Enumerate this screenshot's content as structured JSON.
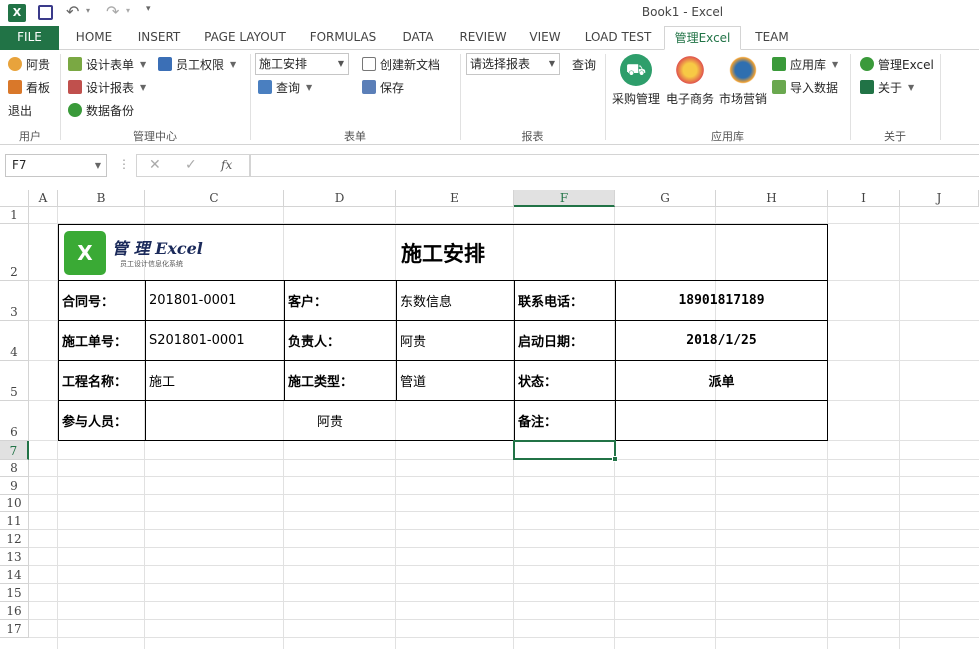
{
  "title": "Book1 - Excel",
  "qat": {
    "customize": "▾"
  },
  "tabs": [
    {
      "label": "FILE"
    },
    {
      "label": "HOME"
    },
    {
      "label": "INSERT"
    },
    {
      "label": "PAGE LAYOUT"
    },
    {
      "label": "FORMULAS"
    },
    {
      "label": "DATA"
    },
    {
      "label": "REVIEW"
    },
    {
      "label": "VIEW"
    },
    {
      "label": "LOAD TEST"
    },
    {
      "label": "管理Excel"
    },
    {
      "label": "TEAM"
    }
  ],
  "ribbon": {
    "user": {
      "name": "阿贵",
      "view": "看板",
      "logout": "退出",
      "group": "用户"
    },
    "manage": {
      "design_form": "设计表单",
      "staff_perm": "员工权限",
      "design_report": "设计报表",
      "backup": "数据备份",
      "group": "管理中心"
    },
    "form": {
      "select_value": "施工安排",
      "query": "查询",
      "create_doc": "创建新文档",
      "save": "保存",
      "group": "表单"
    },
    "report": {
      "select_value": "请选择报表",
      "query": "查询",
      "group": "报表"
    },
    "apps": {
      "purchase": "采购管理",
      "ecommerce": "电子商务",
      "marketing": "市场营销",
      "app_store": "应用库",
      "import": "导入数据",
      "group": "应用库"
    },
    "about": {
      "manage_excel": "管理Excel",
      "about": "关于",
      "group": "关于"
    }
  },
  "formula_bar": {
    "name_box": "F7",
    "fx": "fx",
    "formula": ""
  },
  "columns": [
    "A",
    "B",
    "C",
    "D",
    "E",
    "F",
    "G",
    "H",
    "I",
    "J"
  ],
  "rows": [
    "1",
    "2",
    "3",
    "4",
    "5",
    "6",
    "7",
    "8",
    "9",
    "10",
    "11",
    "12",
    "13",
    "14",
    "15",
    "16",
    "17"
  ],
  "logo": {
    "text": "管 理 Excel",
    "sub": "员工设计信息化系统"
  },
  "form_table": {
    "title": "施工安排",
    "contract_no_label": "合同号：",
    "contract_no": "201801-0001",
    "customer_label": "客户：",
    "customer": "东数信息",
    "phone_label": "联系电话：",
    "phone": "18901817189",
    "work_no_label": "施工单号：",
    "work_no": "S201801-0001",
    "owner_label": "负责人：",
    "owner": "阿贵",
    "start_label": "启动日期：",
    "start": "2018/1/25",
    "project_label": "工程名称：",
    "project": "施工",
    "type_label": "施工类型：",
    "type": "管道",
    "status_label": "状态：",
    "status": "派单",
    "members_label": "参与人员：",
    "members": "阿贵",
    "remark_label": "备注：",
    "remark": ""
  },
  "colors": {
    "excel_green": "#217346",
    "file_tab": "#217346"
  }
}
